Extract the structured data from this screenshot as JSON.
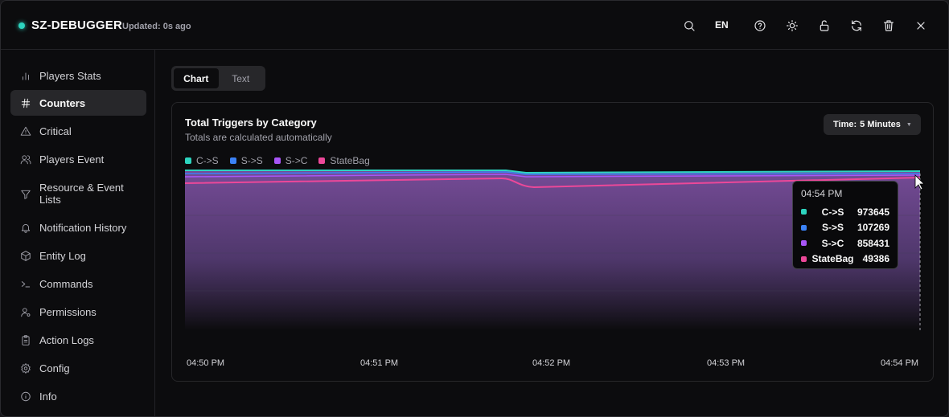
{
  "header": {
    "title": "SZ-DEBUGGER",
    "updated": "Updated: 0s ago",
    "language": "EN",
    "status_color": "#2dd4bf"
  },
  "sidebar": {
    "items": [
      {
        "label": "Players Stats",
        "icon": "bar-chart-icon"
      },
      {
        "label": "Counters",
        "icon": "hash-icon",
        "active": true
      },
      {
        "label": "Critical",
        "icon": "warning-icon"
      },
      {
        "label": "Players Event",
        "icon": "users-icon"
      },
      {
        "label": "Resource & Event Lists",
        "icon": "filter-icon"
      },
      {
        "label": "Notification History",
        "icon": "bell-icon"
      },
      {
        "label": "Entity Log",
        "icon": "box-icon"
      },
      {
        "label": "Commands",
        "icon": "terminal-icon"
      },
      {
        "label": "Permissions",
        "icon": "user-cog-icon"
      },
      {
        "label": "Action Logs",
        "icon": "clipboard-icon"
      },
      {
        "label": "Config",
        "icon": "gear-icon"
      },
      {
        "label": "Info",
        "icon": "info-icon"
      }
    ]
  },
  "tabs": [
    {
      "label": "Chart",
      "active": true
    },
    {
      "label": "Text",
      "active": false
    }
  ],
  "card": {
    "time_label": "Time:",
    "time_value": "5 Minutes"
  },
  "tooltip": {
    "time": "04:54 PM",
    "rows": [
      {
        "name": "C->S",
        "value": "973645",
        "color": "#2dd4bf"
      },
      {
        "name": "S->S",
        "value": "107269",
        "color": "#3b82f6"
      },
      {
        "name": "S->C",
        "value": "858431",
        "color": "#a855f7"
      },
      {
        "name": "StateBag",
        "value": "49386",
        "color": "#ec4899"
      }
    ]
  },
  "chart_data": {
    "type": "area",
    "title": "Total Triggers by Category",
    "subtitle": "Totals are calculated automatically",
    "x_ticks": [
      "04:50 PM",
      "04:51 PM",
      "04:52 PM",
      "04:53 PM",
      "04:54 PM"
    ],
    "series": [
      {
        "name": "C->S",
        "color": "#2dd4bf"
      },
      {
        "name": "S->S",
        "color": "#3b82f6"
      },
      {
        "name": "S->C",
        "color": "#a855f7"
      },
      {
        "name": "StateBag",
        "color": "#ec4899"
      }
    ],
    "grid": true,
    "legend": "top-left"
  }
}
